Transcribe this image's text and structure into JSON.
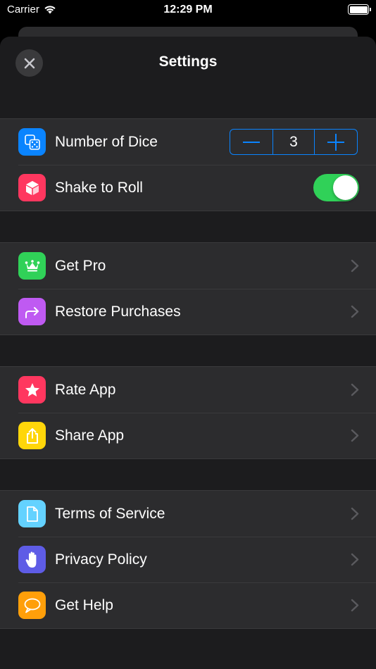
{
  "status_bar": {
    "carrier": "Carrier",
    "time": "12:29 PM",
    "icons": [
      "wifi-icon",
      "battery-icon"
    ]
  },
  "nav": {
    "title": "Settings",
    "close_icon": "close-icon"
  },
  "groups": [
    {
      "rows": [
        {
          "label": "Number of Dice",
          "icon": "dice-icon",
          "icon_color": "#0a84ff",
          "control": "stepper",
          "value": "3"
        },
        {
          "label": "Shake to Roll",
          "icon": "cube-icon",
          "icon_color": "#ff375f",
          "control": "toggle",
          "on": true
        }
      ]
    },
    {
      "rows": [
        {
          "label": "Get Pro",
          "icon": "crown-icon",
          "icon_color": "#30d158"
        },
        {
          "label": "Restore Purchases",
          "icon": "share-arrow-icon",
          "icon_color": "#bf5af2"
        }
      ]
    },
    {
      "rows": [
        {
          "label": "Rate App",
          "icon": "star-icon",
          "icon_color": "#ff375f"
        },
        {
          "label": "Share App",
          "icon": "upload-icon",
          "icon_color": "#ffd60a"
        }
      ]
    },
    {
      "rows": [
        {
          "label": "Terms of Service",
          "icon": "document-icon",
          "icon_color": "#64d2ff"
        },
        {
          "label": "Privacy Policy",
          "icon": "hand-icon",
          "icon_color": "#5e5ce6"
        },
        {
          "label": "Get Help",
          "icon": "chat-bubble-icon",
          "icon_color": "#ff9f0a"
        }
      ]
    }
  ],
  "colors": {
    "background": "#1c1c1e",
    "cell": "#2c2c2e",
    "accent": "#0a84ff",
    "toggle_on": "#30d158"
  }
}
